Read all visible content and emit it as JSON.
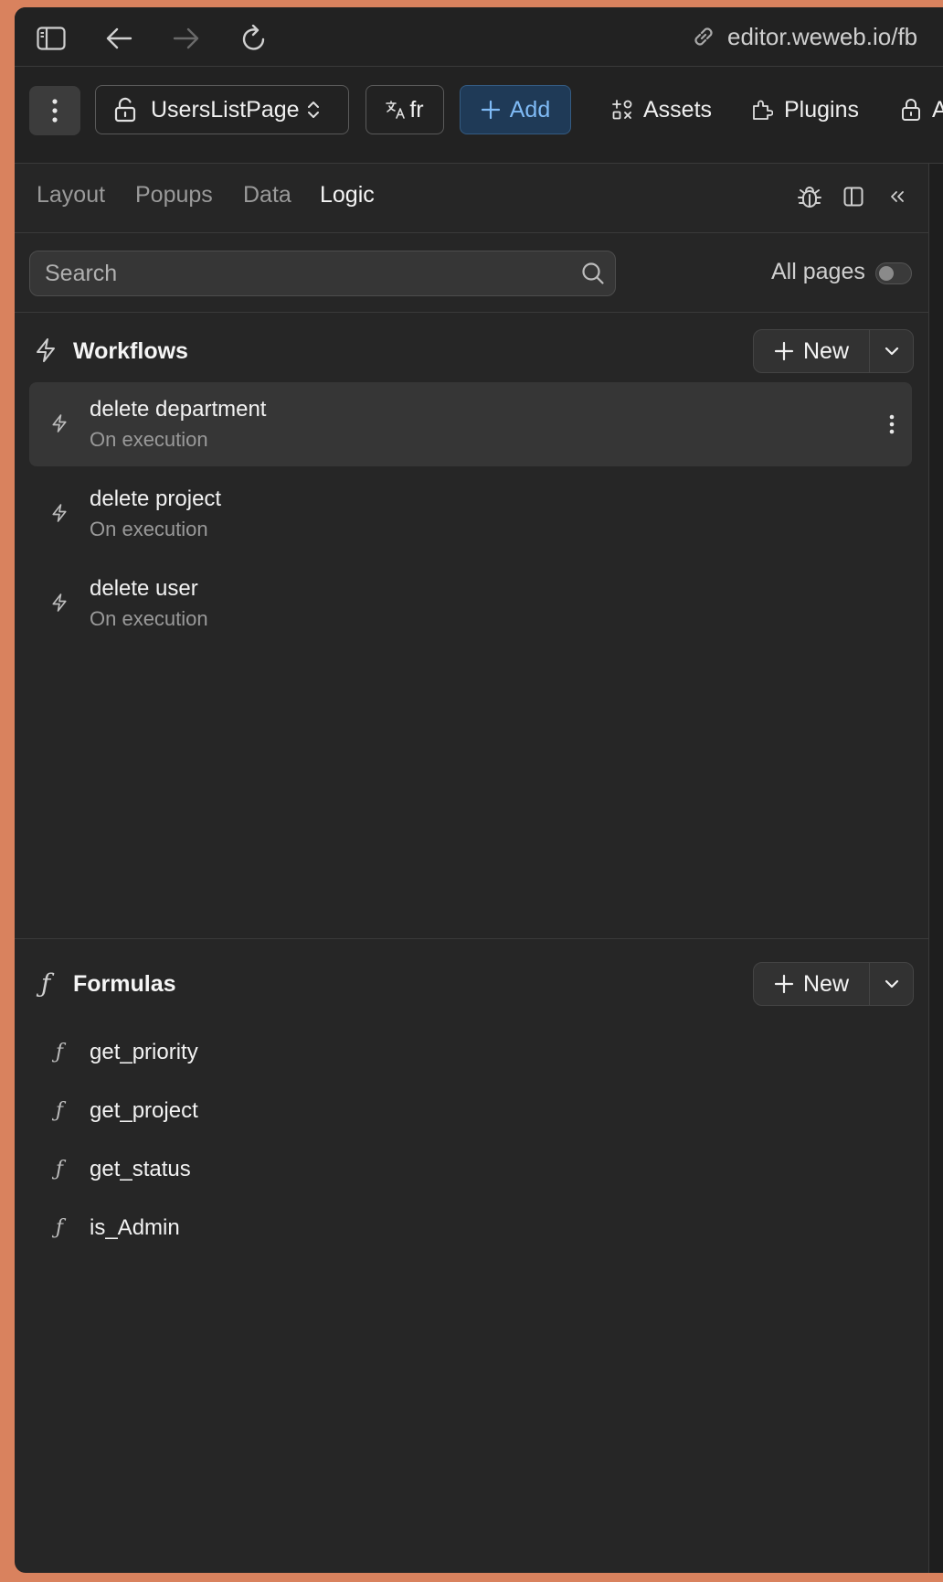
{
  "browser": {
    "url": "editor.weweb.io/fb"
  },
  "toolbar": {
    "page_name": "UsersListPage",
    "lang": "fr",
    "add_label": "Add",
    "assets_label": "Assets",
    "plugins_label": "Plugins",
    "auth_label": "Au"
  },
  "tabs": [
    "Layout",
    "Popups",
    "Data",
    "Logic"
  ],
  "active_tab": "Logic",
  "search": {
    "placeholder": "Search",
    "value": ""
  },
  "all_pages_label": "All pages",
  "workflows": {
    "title": "Workflows",
    "new_label": "New",
    "items": [
      {
        "name": "delete department",
        "trigger": "On execution"
      },
      {
        "name": "delete project",
        "trigger": "On execution"
      },
      {
        "name": "delete user",
        "trigger": "On execution"
      }
    ]
  },
  "formulas": {
    "title": "Formulas",
    "new_label": "New",
    "items": [
      {
        "name": "get_priority"
      },
      {
        "name": "get_project"
      },
      {
        "name": "get_status"
      },
      {
        "name": "is_Admin"
      }
    ]
  },
  "colors": {
    "background": "#262626",
    "accent": "#7fbaf5",
    "accent_bg": "#1f3a57",
    "selected_row": "#363636"
  }
}
